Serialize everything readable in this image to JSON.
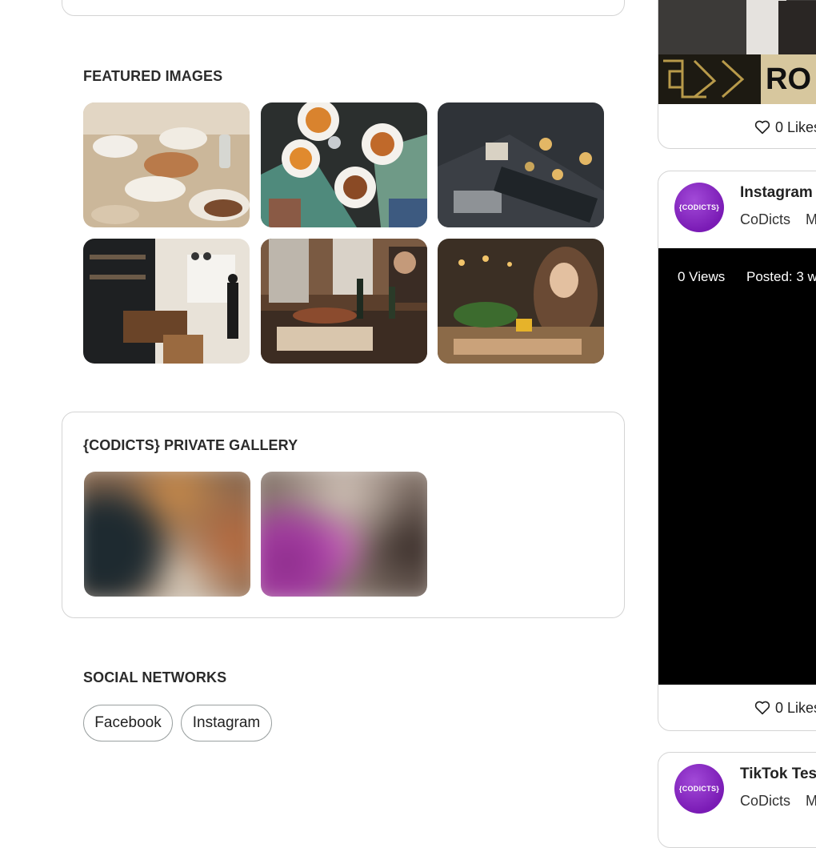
{
  "left": {
    "featured_title": "FEATURED IMAGES",
    "featured_images": [
      {
        "name": "image-dining-table"
      },
      {
        "name": "image-fries-overhead"
      },
      {
        "name": "image-restaurant-overhead"
      },
      {
        "name": "image-bar-interior"
      },
      {
        "name": "image-friends-dining"
      },
      {
        "name": "image-woman-eating"
      }
    ],
    "private_gallery_title": "{CODICTS} PRIVATE GALLERY",
    "private_images": [
      {
        "name": "private-image-1"
      },
      {
        "name": "private-image-2"
      }
    ],
    "social_title": "SOCIAL NETWORKS",
    "social_links": [
      "Facebook",
      "Instagram"
    ]
  },
  "right": {
    "post1": {
      "likes": "0 Likes",
      "banner_text": "RO"
    },
    "post2": {
      "title": "Instagram T",
      "author": "CoDicts",
      "author_extra": "M",
      "avatar_text": "{CODICTS}",
      "views": "0 Views",
      "posted": "Posted: 3 w",
      "likes": "0 Likes"
    },
    "post3": {
      "title": "TikTok Test",
      "author": "CoDicts",
      "author_extra": "M",
      "avatar_text": "{CODICTS}"
    }
  },
  "colors": {
    "accent_purple": "#8a2bc6",
    "border": "#d4d4d4"
  }
}
